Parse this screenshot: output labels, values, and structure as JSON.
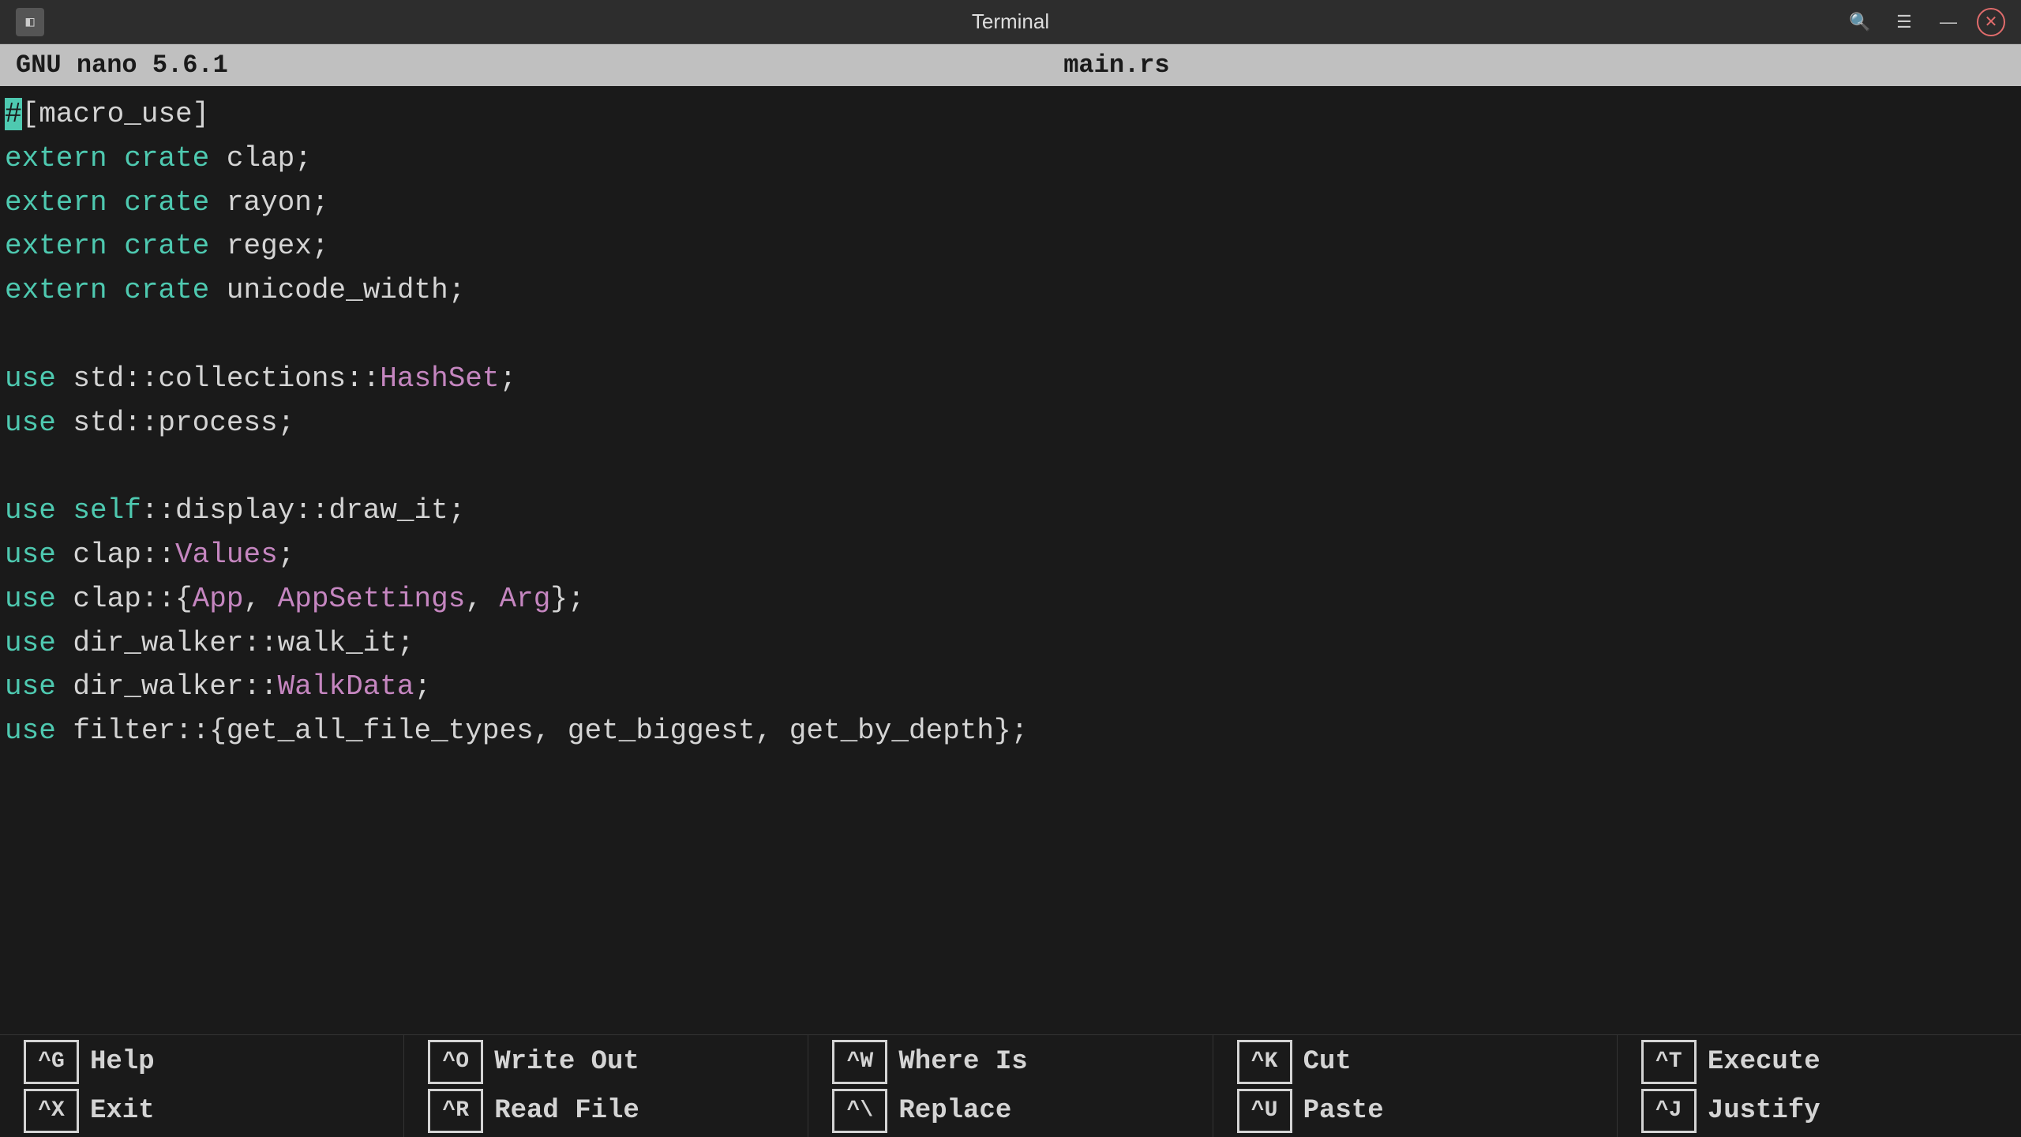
{
  "titlebar": {
    "app_icon": "◧",
    "title": "Terminal",
    "search_icon": "🔍",
    "menu_icon": "☰",
    "minimize_icon": "—",
    "close_icon": "✕"
  },
  "nano_header": {
    "left": "GNU nano 5.6.1",
    "center": "main.rs",
    "right": ""
  },
  "code_lines": [
    "#[macro_use]",
    "extern crate clap;",
    "extern crate rayon;",
    "extern crate regex;",
    "extern crate unicode_width;",
    "",
    "use std::collections::HashSet;",
    "use std::process;",
    "",
    "use self::display::draw_it;",
    "use clap::Values;",
    "use clap::{App, AppSettings, Arg};",
    "use dir_walker::walk_it;",
    "use dir_walker::WalkData;",
    "use filter::{get_all_file_types, get_biggest, get_by_depth};"
  ],
  "shortcuts": [
    {
      "rows": [
        {
          "key": "^G",
          "label": "Help"
        },
        {
          "key": "^X",
          "label": "Exit"
        }
      ]
    },
    {
      "rows": [
        {
          "key": "^O",
          "label": "Write Out"
        },
        {
          "key": "^R",
          "label": "Read File"
        }
      ]
    },
    {
      "rows": [
        {
          "key": "^W",
          "label": "Where Is"
        },
        {
          "key": "^\\",
          "label": "Replace"
        }
      ]
    },
    {
      "rows": [
        {
          "key": "^K",
          "label": "Cut"
        },
        {
          "key": "^U",
          "label": "Paste"
        }
      ]
    },
    {
      "rows": [
        {
          "key": "^T",
          "label": "Execute"
        },
        {
          "key": "^J",
          "label": "Justify"
        }
      ]
    }
  ]
}
